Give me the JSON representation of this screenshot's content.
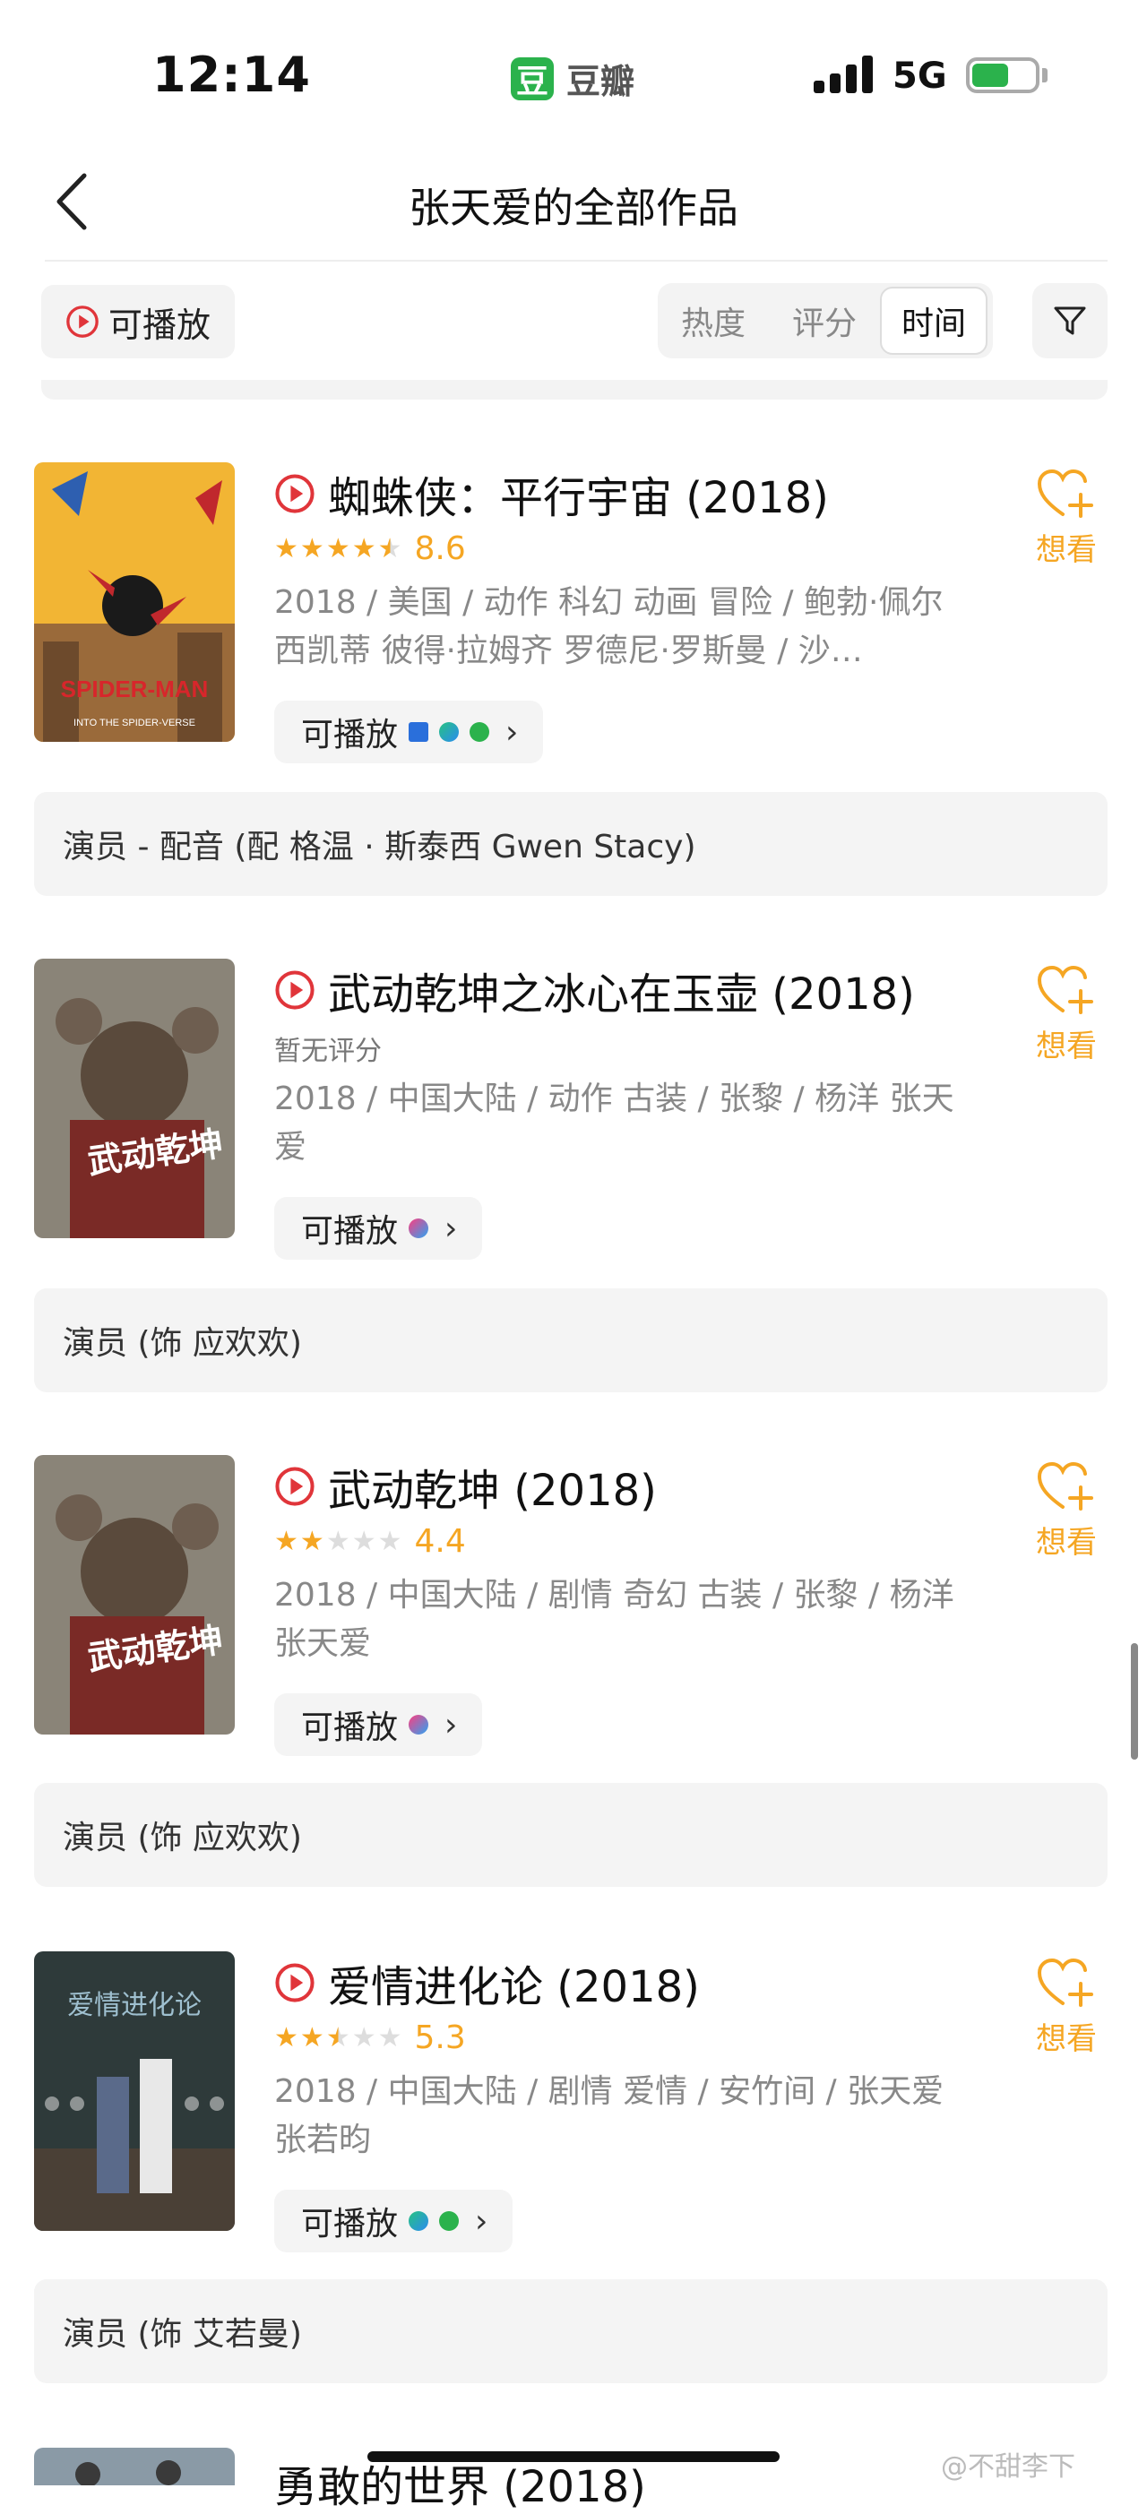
{
  "status_bar": {
    "time": "12:14",
    "app_name": "豆瓣",
    "app_logo_char": "豆",
    "network": "5G"
  },
  "header": {
    "title": "张天爱的全部作品"
  },
  "filters": {
    "playable_label": "可播放",
    "sort_tabs": [
      "热度",
      "评分",
      "时间"
    ],
    "active_sort": "时间"
  },
  "entries": [
    {
      "title": "蜘蛛侠：平行宇宙 (2018)",
      "stars": 4.5,
      "score": "8.6",
      "meta": "2018 / 美国 / 动作 科幻 动画 冒险 / 鲍勃·佩尔西凯蒂 彼得·拉姆齐 罗德尼·罗斯曼 / 沙…",
      "play_label": "可播放",
      "providers": [
        "mgtv-icon",
        "tencent-video-icon",
        "iqiyi-icon"
      ],
      "want_label": "想看",
      "role": "演员 - 配音 (配 格温 · 斯泰西 Gwen Stacy)"
    },
    {
      "title": "武动乾坤之冰心在玉壶 (2018)",
      "no_rating": "暂无评分",
      "meta": "2018 / 中国大陆 / 动作 古装 / 张黎 / 杨洋 张天爱",
      "play_label": "可播放",
      "providers": [
        "youku-icon"
      ],
      "want_label": "想看",
      "role": "演员 (饰 应欢欢)"
    },
    {
      "title": "武动乾坤 (2018)",
      "stars": 2,
      "score": "4.4",
      "meta": "2018 / 中国大陆 / 剧情 奇幻 古装 / 张黎 / 杨洋 张天爱",
      "play_label": "可播放",
      "providers": [
        "youku-icon"
      ],
      "want_label": "想看",
      "role": "演员 (饰 应欢欢)"
    },
    {
      "title": "爱情进化论 (2018)",
      "stars": 2.5,
      "score": "5.3",
      "meta": "2018 / 中国大陆 / 剧情 爱情 / 安竹间 / 张天爱 张若昀",
      "play_label": "可播放",
      "providers": [
        "tencent-video-icon",
        "iqiyi-icon"
      ],
      "want_label": "想看",
      "role": "演员 (饰 艾若曼)"
    },
    {
      "title": "勇敢的世界 (2018)"
    }
  ],
  "poster_texts": {
    "spiderman": "SPIDER-MAN",
    "spiderman_sub": "INTO THE SPIDER-VERSE",
    "wudong": "武动乾坤",
    "aiqing": "爱情进化论"
  },
  "watermark": "@不甜李下",
  "colors": {
    "accent": "#f5a623",
    "play_red": "#e0353a",
    "douban_green": "#2bb24c"
  }
}
